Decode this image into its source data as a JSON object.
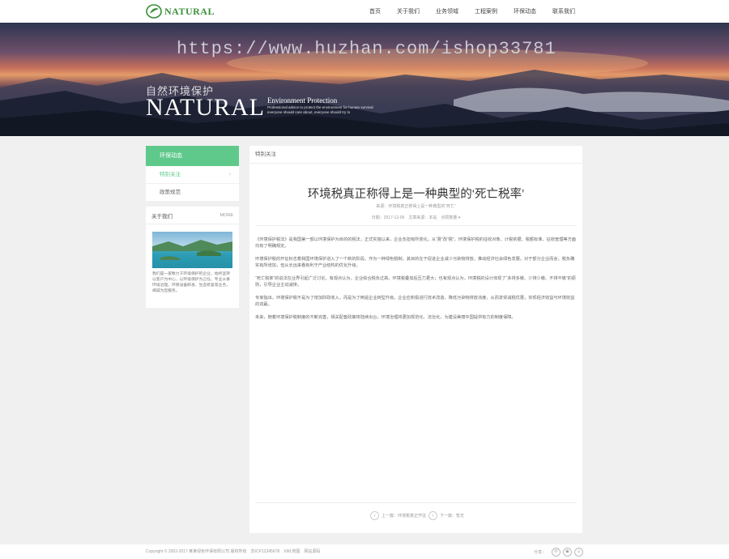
{
  "header": {
    "logo_text": "NATURAL",
    "nav": [
      "首页",
      "关于我们",
      "业务领域",
      "工程案例",
      "环保动态",
      "联系我们"
    ]
  },
  "banner": {
    "watermark": "https://www.huzhan.com/ishop33781",
    "title_cn": "自然环境保护",
    "title_en": "NATURAL",
    "subtitle": "Environment Protection",
    "small_line1": "Professional advice to protect the environment for human survival",
    "small_line2": "everyone should care about, everyone should try to"
  },
  "sidebar": {
    "heading": "环保动态",
    "items": [
      {
        "label": "特别关注",
        "active": true
      },
      {
        "label": "政策规范",
        "active": false
      }
    ]
  },
  "about": {
    "title": "关于我们",
    "more": "MORE",
    "text": "我们是一家致力于环境保护的企业，始终坚持以客户为中心，以环境保护为己任，专业从事环境治理、环保设备研发、生态修复等业务，竭诚为您服务。"
  },
  "main": {
    "section_title": "特别关注",
    "article_title": "环境税真正称得上是一种典型的‘死亡税率’",
    "source": "来源：环境税真正称得上是一种典型的“死亡”",
    "meta": "日期：2017-12-09　文章来源：本站　点赞数量 ▾",
    "paragraphs": [
      "《环境保护税法》是我国第一部以环境保护为目的的税法，正式实施以来，企业负担有所变化。从“费”改“税”，环境保护税的征收对象、计税依据、税额标准、征收管理等方面均有了明确规定。",
      "环境保护税的开征标志着我国环境保护进入了一个新的阶段。作为一种绿色税制，其目的在于促进企业减少污染物排放，推动经济社会绿色发展。对于部分企业而言，税负确实有所增加，但从长远来看有利于产业结构的优化升级。",
      "“死亡税率”的说法在业界引起广泛讨论。有观点认为，企业综合税负过高，环境税叠加后压力更大；也有观点认为，环境税的设计体现了“多排多缴、少排少缴、不排不缴”的原则，引导企业主动减排。",
      "专家指出，环境保护税不是为了增加财政收入，而是为了倒逼企业转型升级。企业应积极进行技术改造，降低污染物排放浓度，从而享受减税优惠，实现经济效益与环境效益的双赢。",
      "未来，随着环境保护税制度的不断完善，相关配套政策将陆续出台，环境治理将更加规范化、法治化，为建设美丽中国提供有力的制度保障。"
    ],
    "prev_label": "上一篇：环境税真正开征",
    "next_label": "下一篇：暂无"
  },
  "footer": {
    "copyright": "Copyright © 2002-2017 某某绿色环保有限公司 版权所有　苏ICP12345678　XML地图　网站源码",
    "share_label": "分享："
  }
}
